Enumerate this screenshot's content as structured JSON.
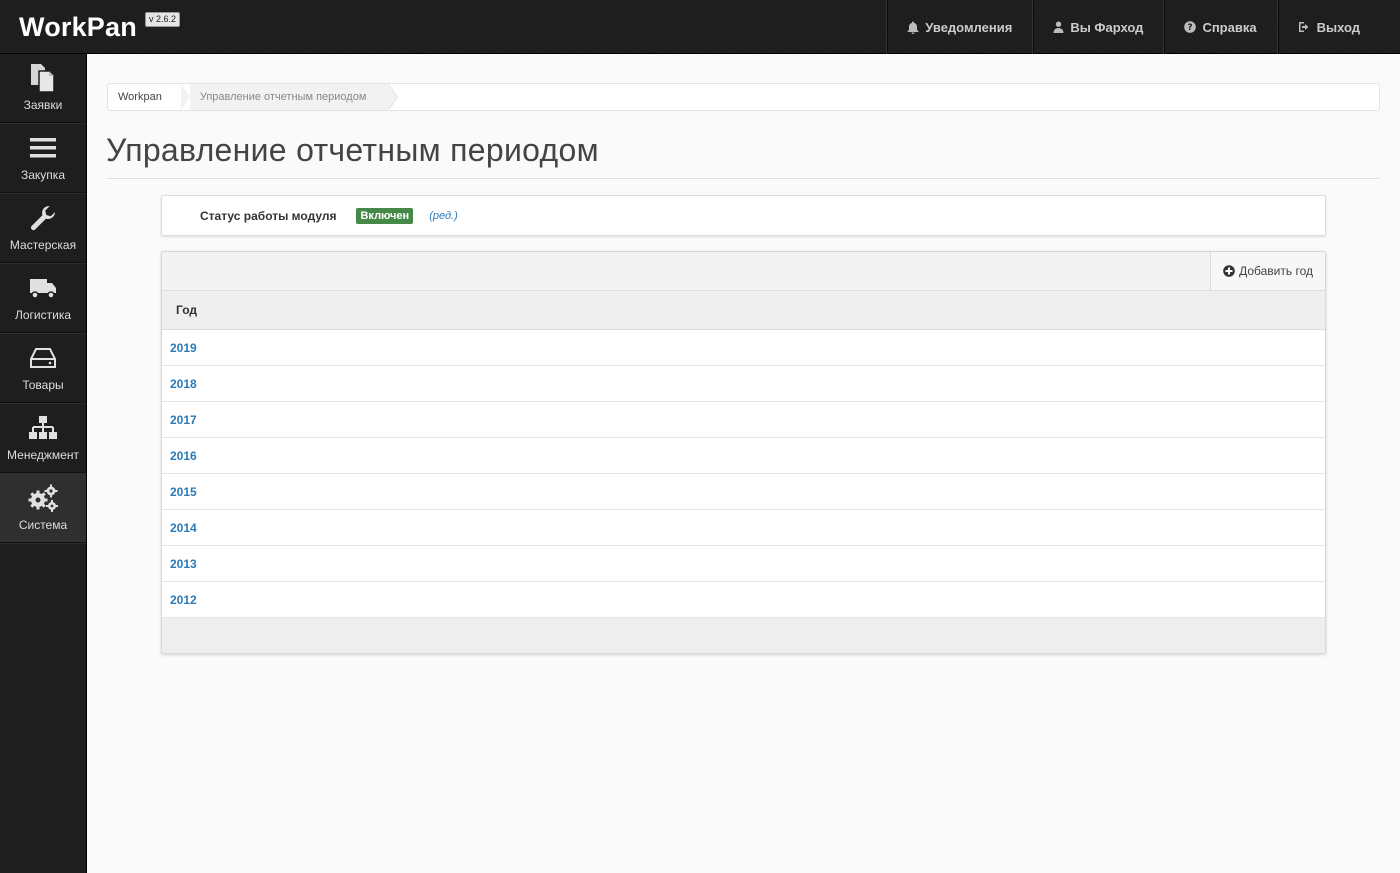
{
  "app": {
    "brand": "WorkPan",
    "version": "v 2.6.2"
  },
  "topnav": {
    "notifications": {
      "label": "Уведомления",
      "icon": "bell-icon"
    },
    "user": {
      "label": "Вы Фарход",
      "icon": "user-icon"
    },
    "help": {
      "label": "Справка",
      "icon": "question-circle-icon"
    },
    "logout": {
      "label": "Выход",
      "icon": "sign-out-icon"
    }
  },
  "sidebar": {
    "items": [
      {
        "label": "Заявки",
        "icon": "documents-icon",
        "active": false
      },
      {
        "label": "Закупка",
        "icon": "list-icon",
        "active": false
      },
      {
        "label": "Мастерская",
        "icon": "wrench-icon",
        "active": false
      },
      {
        "label": "Логистика",
        "icon": "truck-icon",
        "active": false
      },
      {
        "label": "Товары",
        "icon": "hdd-icon",
        "active": false
      },
      {
        "label": "Менеджмент",
        "icon": "sitemap-icon",
        "active": false
      },
      {
        "label": "Система",
        "icon": "cogs-icon",
        "active": true
      }
    ]
  },
  "breadcrumb": {
    "home": "Workpan",
    "current": "Управление отчетным периодом"
  },
  "page": {
    "title": "Управление отчетным периодом"
  },
  "status": {
    "label": "Статус работы модуля",
    "badge": "Включен",
    "badge_color": "#468847",
    "edit": "(ред.)"
  },
  "table": {
    "add_button": "Добавить год",
    "column": "Год",
    "rows": [
      "2019",
      "2018",
      "2017",
      "2016",
      "2015",
      "2014",
      "2013",
      "2012"
    ]
  },
  "colors": {
    "topbar": "#1c1c1c",
    "sidebar": "#1e1e1e",
    "link": "#2a7ab8"
  }
}
